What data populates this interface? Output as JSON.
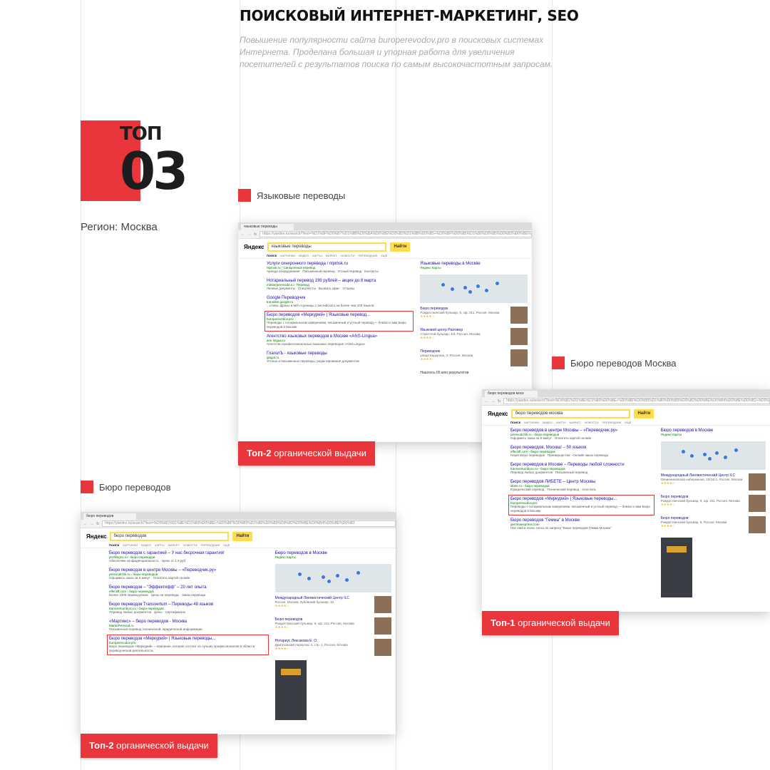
{
  "header": {
    "title": "ПОИСКОВЫЙ ИНТЕРНЕТ-МАРКЕТИНГ, SEO",
    "subtitle": "Повышение популярности сайта buroperevodov.pro в поисковых системах Интернета. Проделана большая и упорная работа для увеличения посетителей с результатов поиска по самым высокочастотным запросам."
  },
  "top": {
    "word": "ТОП",
    "number": "03"
  },
  "region": "Регион: Москва",
  "accent": "#e8363c",
  "sections": [
    {
      "label": "Языковые переводы",
      "badge_bold": "Топ-2",
      "badge_rest": " органической выдачи",
      "tab": "языковые переводы",
      "query": "языковые переводы",
      "url": "https://yandex.ru/search/?text=%D1%8F%D0%B7%D1%8B%D0%BA%D0%BE%D0%B2%D1%8B%D0%B5+%D0%BF%D0%B5%D1%80%D0%B5%D0%B2%D0%BE%D0%B4%D1%8B",
      "results": [
        {
          "title": "Услуги синхронного перевода / nlpmsk.ru",
          "url": "nlpmsk.ru › Синхронный перевод",
          "desc": "Аренда оборудования · Письменный перевод · Устный перевод · Контакты"
        },
        {
          "title": "Нотариальный перевод 199 рублей – акция до 8 марта",
          "url": "masterperevoda.ru › Перевод",
          "desc": "Личные документы · Спецтексты · Вызвать офис · Отзывы"
        },
        {
          "title": "Google Переводчик",
          "url": "translate.google.ru",
          "desc": "...слова, фразы и веб-страницы с английского на более чем 100 языков."
        },
        {
          "title": "Бюро переводов «Меркурий» | Языковые перевод...",
          "url": "buroperevodov.pro",
          "desc": "Переводы с нотариальным заверением, письменный и устный перевод — близко к вам Бюро переводов в Москве",
          "highlight": true
        },
        {
          "title": "Агентство языковых переводов в Москве «ANS-Lingua»",
          "url": "ans-lingua.ru",
          "desc": "Агентство профессиональных языковых переводов «ANS-Lingua»"
        },
        {
          "title": "ГлаголЪ - языковые переводы",
          "url": "glagol.ru",
          "desc": "Устные и письменные переводы, редактирование документов"
        }
      ],
      "side": {
        "title": "Языковые переводы в Москве",
        "sub": "Яндекс Карты",
        "orgs": [
          {
            "name": "Бюро переводов",
            "addr": "Рождественский бульвар, 9, оф. 311, Россия, Москва"
          },
          {
            "name": "Языковой центр Разговор",
            "addr": "Страстной бульвар, 4/3, Россия, Москва"
          },
          {
            "name": "Переводчик",
            "addr": "улица Кадорова, 3, Россия, Москва"
          }
        ],
        "count": "Нашлось 65 млн результатов"
      }
    },
    {
      "label": "Бюро переводов Москва",
      "badge_bold": "Топ-1",
      "badge_rest": " органической выдачи",
      "tab": "бюро переводов моск",
      "query": "бюро переводов москва",
      "url": "https://yandex.ru/search/?text=%D0%B1%D1%8E%D1%80%D0%BE+%D0%BF%D0%B5%D1%80%D0%B5%D0%B2%D0%BE%D0%B4%D0%BE%D0%B2+%D0%BC%D0%BE%D1%81%D0%BA%D0%B2%D0%B0",
      "results": [
        {
          "title": "Бюро переводов в центре Москвы – «Переводчик.ру»",
          "url": "perevodchik.ru › бюро-переводов",
          "desc": "Оформить заказ за 5 минут · Оплатить картой онлайн"
        },
        {
          "title": "Бюро переводов, Москва! – 50 языков",
          "url": "effectiff.com › бюро-переводов",
          "desc": "Наши Бюро переводов · Преимущества · Онлайн заказ перевода"
        },
        {
          "title": "Бюро переводов в Москве – Переводы любой сложности",
          "url": "transvertumburo.ru › бюро-переводов",
          "desc": "Перевод любых документов · Письменный перевод"
        },
        {
          "title": "Бюро переводов ЛИБЕТЕ – Центр Москвы",
          "url": "libete.ru › бюро-переводов",
          "desc": "Юридический перевод · Технический перевод · Апостиль"
        },
        {
          "title": "Бюро переводов «Меркурий» | Языковые переводы...",
          "url": "buroperevodov.pro",
          "desc": "Переводы с нотариальным заверением, письменный и устный перевод — близко к вам Бюро переводов в Москве",
          "highlight": true
        },
        {
          "title": "Бюро переводов \"Гемма\" в Москве",
          "url": "gemmaexpress.com",
          "desc": "Нас найти очень легко по запросу \"Бюро переводов Гемма Москва\""
        }
      ],
      "side": {
        "title": "Бюро переводов в Москве",
        "sub": "Яндекс Карты",
        "orgs": [
          {
            "name": "Международный Лингвистический Центр ILC",
            "addr": "Овчинниковская набережная, 22/24с1, Россия, Москва"
          },
          {
            "name": "Бюро переводов",
            "addr": "Рождественский бульвар, 9, оф. 311, Россия, Москва"
          },
          {
            "name": "Бюро переводов",
            "addr": "Рождественский бульвар, 9, Россия, Москва"
          }
        ],
        "count": ""
      }
    },
    {
      "label": "Бюро переводов",
      "badge_bold": "Топ-2",
      "badge_rest": " органической выдачи",
      "tab": "бюро переводов",
      "query": "бюро переводов",
      "url": "https://yandex.ru/search/?text=%D0%B1%D1%8E%D1%80%D0%BE+%D0%BF%D0%B5%D1%80%D0%B5%D0%B2%D0%BE%D0%B4%D0%BE%D0%B2",
      "results": [
        {
          "title": "Бюро переводов с гарантией – У нас бесрочная гарантия!",
          "url": "profilingvo.ru › бюро-переводов",
          "desc": "Обеспечим конфиденциальность · Цены от 1.5 руб"
        },
        {
          "title": "Бюро переводов в центре Москвы – «Переводчик.ру»",
          "url": "perevodchik.ru › бюро-переводов",
          "desc": "Оформить заказ за 5 минут · Оплатить картой онлайн"
        },
        {
          "title": "Бюро переводов – \"Эффектифф\" – 20 лет опыта",
          "url": "effectiff.com › бюро-переводов",
          "desc": "Более 1000 переводчиков · Цены на переводы · Заказ перевода"
        },
        {
          "title": "Бюро переводов Transvertum – Переводы 48 языков",
          "url": "transvertumburo.ru › бюро-переводов",
          "desc": "Перевод любых документов · Цены · Сертификаты"
        },
        {
          "title": "«Мартинс» – бюро переводов - Москва",
          "url": "MartinPerevod.ru",
          "desc": "Письменный перевод технической, юридической информации"
        },
        {
          "title": "Бюро переводов «Меркурий» | Языковые переводы...",
          "url": "buroperevodov.pro",
          "desc": "Бюро переводов «Меркурий» – компания, которая состоит из лучших профессионалов в области переводческой деятельности.",
          "highlight": true
        }
      ],
      "side": {
        "title": "Бюро переводов в Москве",
        "sub": "Яндекс Карты",
        "orgs": [
          {
            "name": "Международный Лингвистический Центр ILC",
            "addr": "Россия, Москва, Зубовский бульвар, 13"
          },
          {
            "name": "Бюро переводов",
            "addr": "Рождественский бульвар, 9, оф. 311, Россия, Москва"
          },
          {
            "name": "Нотариус Лексакова Е. О.",
            "addr": "Дмитровский переулок, 2, стр. 1, Россия, Москва"
          }
        ],
        "count": ""
      }
    }
  ],
  "ui": {
    "logo": "Яндекс",
    "search_btn": "Найти",
    "tabs": [
      "Поиск",
      "Картинки",
      "Видео",
      "Карты",
      "Маркет",
      "Новости",
      "Переводчик",
      "Ещё"
    ]
  }
}
